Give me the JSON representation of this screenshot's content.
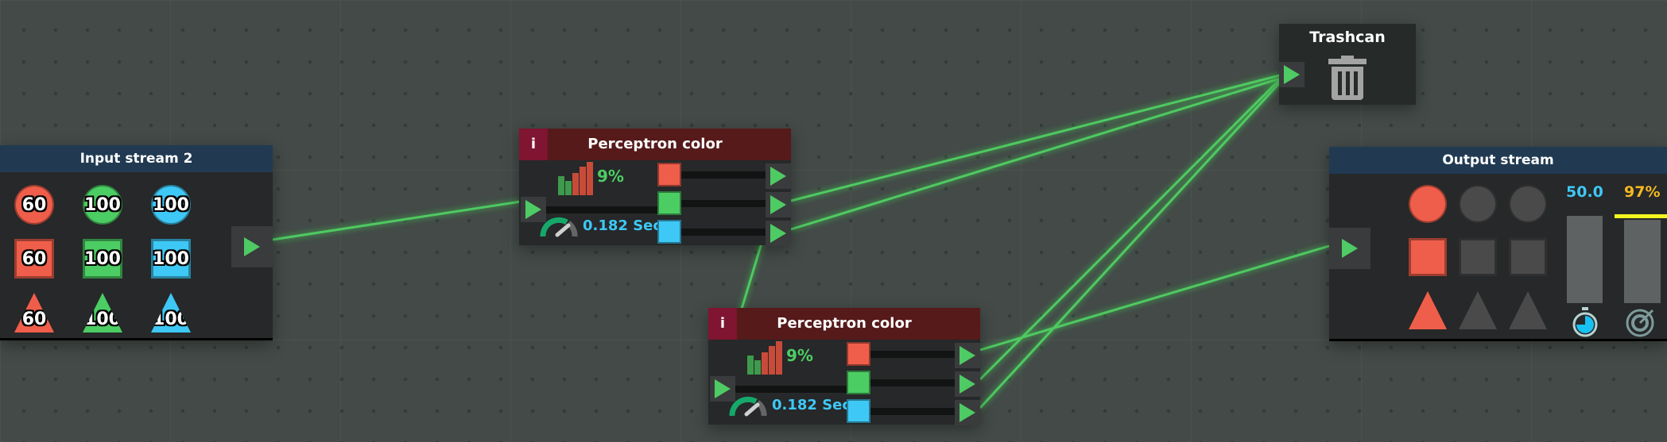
{
  "input_node": {
    "title": "Input stream 2",
    "items": [
      {
        "shape": "circle",
        "color": "#ef5e4a",
        "value": "60"
      },
      {
        "shape": "circle",
        "color": "#4ccd63",
        "value": "100"
      },
      {
        "shape": "circle",
        "color": "#3ec8f5",
        "value": "100"
      },
      {
        "shape": "square",
        "color": "#ef5e4a",
        "value": "60"
      },
      {
        "shape": "square",
        "color": "#4ccd63",
        "value": "100"
      },
      {
        "shape": "square",
        "color": "#3ec8f5",
        "value": "100"
      },
      {
        "shape": "triangle",
        "color": "#ef5e4a",
        "value": "60"
      },
      {
        "shape": "triangle",
        "color": "#4ccd63",
        "value": "100"
      },
      {
        "shape": "triangle",
        "color": "#3ec8f5",
        "value": "100"
      }
    ]
  },
  "perceptrons": [
    {
      "title": "Perceptron color",
      "info": "i",
      "accuracy": "9%",
      "time": "0.182 Sec",
      "outputs": [
        "#ef5e4a",
        "#4ccd63",
        "#3ec8f5"
      ]
    },
    {
      "title": "Perceptron color",
      "info": "i",
      "accuracy": "9%",
      "time": "0.182 Sec",
      "outputs": [
        "#ef5e4a",
        "#4ccd63",
        "#3ec8f5"
      ]
    }
  ],
  "trashcan": {
    "title": "Trashcan",
    "icon": "trash-icon"
  },
  "output_node": {
    "title": "Output stream",
    "speed": "50.0",
    "accuracy": "97%",
    "accuracy_level": 0.97,
    "shapes": [
      {
        "shape": "circle",
        "color": "#ef5e4a"
      },
      {
        "shape": "circle",
        "color": "#4a4a4a"
      },
      {
        "shape": "circle",
        "color": "#4a4a4a"
      },
      {
        "shape": "square",
        "color": "#ef5e4a"
      },
      {
        "shape": "square",
        "color": "#4a4a4a"
      },
      {
        "shape": "square",
        "color": "#4a4a4a"
      },
      {
        "shape": "triangle",
        "color": "#ef5e4a"
      },
      {
        "shape": "triangle",
        "color": "#4a4a4a"
      },
      {
        "shape": "triangle",
        "color": "#4a4a4a"
      }
    ]
  },
  "colors": {
    "wire": "#4ee060",
    "accent_green": "#4ccd63",
    "time_blue": "#3ec8f5",
    "accuracy_yellow": "#f4b820"
  }
}
